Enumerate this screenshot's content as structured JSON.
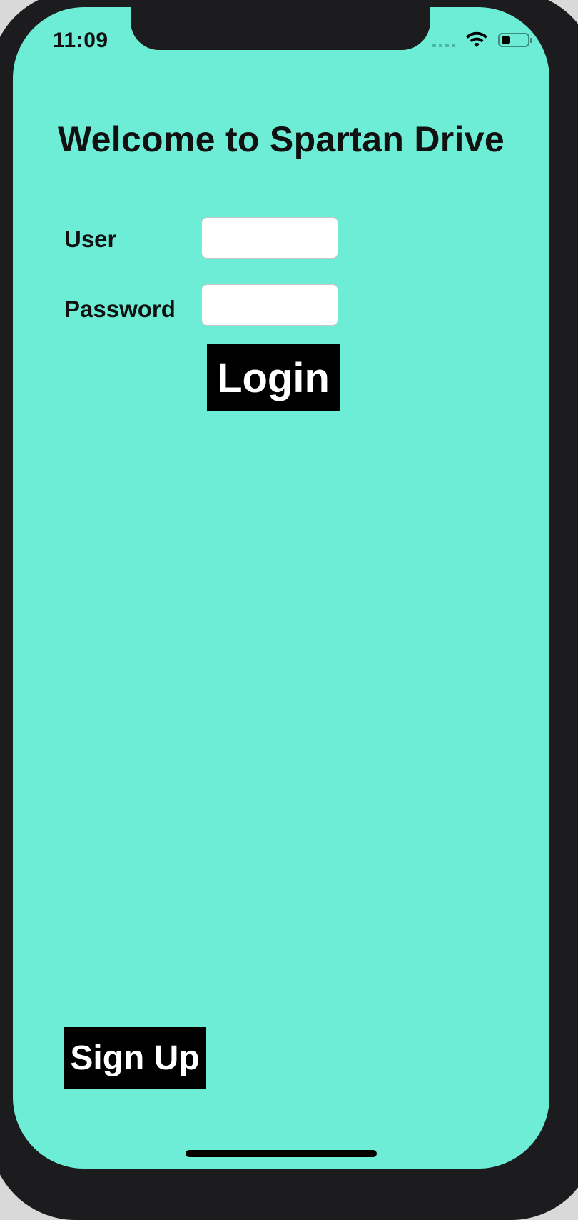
{
  "status_bar": {
    "time": "11:09",
    "icons": [
      "signal-dots-icon",
      "wifi-icon",
      "battery-icon"
    ]
  },
  "screen": {
    "title": "Welcome to Spartan Drive",
    "background_color": "#6eedd6"
  },
  "form": {
    "user_label": "User",
    "user_value": "",
    "password_label": "Password",
    "password_value": ""
  },
  "buttons": {
    "login_label": "Login",
    "signup_label": "Sign Up",
    "color": "#000000",
    "text_color": "#ffffff"
  }
}
